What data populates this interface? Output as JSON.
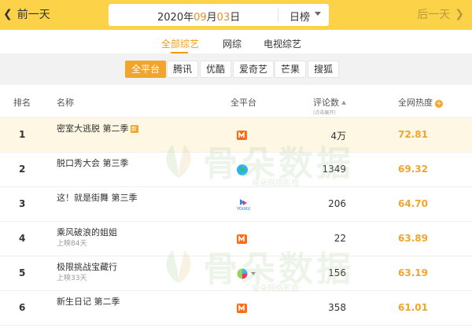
{
  "nav": {
    "prev_label": "前一天",
    "next_label": "后一天"
  },
  "date": {
    "year": "2020",
    "year_unit": "年",
    "month": "09",
    "month_unit": "月",
    "day": "03",
    "day_unit": "日",
    "rank_type": "日榜"
  },
  "category_tabs": [
    {
      "label": "全部综艺",
      "active": true
    },
    {
      "label": "网综",
      "active": false
    },
    {
      "label": "电视综艺",
      "active": false
    }
  ],
  "platform_filters": [
    {
      "label": "全平台",
      "active": true
    },
    {
      "label": "腾讯",
      "active": false
    },
    {
      "label": "优酷",
      "active": false
    },
    {
      "label": "爱奇艺",
      "active": false
    },
    {
      "label": "芒果",
      "active": false
    },
    {
      "label": "搜狐",
      "active": false
    }
  ],
  "table": {
    "headers": {
      "rank": "排名",
      "name": "名称",
      "platform": "全平台",
      "comments": "评论数",
      "comments_sub": "(点击展开)",
      "heat": "全网热度"
    },
    "rows": [
      {
        "rank": "1",
        "name": "密室大逃脱 第二季",
        "sub": "",
        "new_tag": "新",
        "platform_icon": "mango-tv-icon",
        "comments": "4万",
        "heat": "72.81"
      },
      {
        "rank": "2",
        "name": "脱口秀大会 第三季",
        "sub": "",
        "new_tag": "",
        "platform_icon": "tencent-video-icon",
        "comments": "1349",
        "heat": "69.32"
      },
      {
        "rank": "3",
        "name": "这！就是街舞 第三季",
        "sub": "",
        "new_tag": "",
        "platform_icon": "youku-icon",
        "comments": "206",
        "heat": "64.70"
      },
      {
        "rank": "4",
        "name": "乘风破浪的姐姐",
        "sub": "上映84天",
        "new_tag": "",
        "platform_icon": "mango-tv-icon",
        "comments": "22",
        "heat": "63.89"
      },
      {
        "rank": "5",
        "name": "极限挑战宝藏行",
        "sub": "上映33天",
        "new_tag": "",
        "platform_icon": "multi-platform-icon",
        "comments": "156",
        "heat": "63.19"
      },
      {
        "rank": "6",
        "name": "新生日记 第二季",
        "sub": "",
        "new_tag": "",
        "platform_icon": "mango-tv-icon",
        "comments": "358",
        "heat": "61.01"
      }
    ]
  },
  "watermark": {
    "text": "骨朵数据",
    "small_text": "骨朵网络影视"
  },
  "colors": {
    "brand_yellow": "#fcd249",
    "accent_orange": "#f3a52b",
    "highlight_row": "#fdf7e4"
  }
}
